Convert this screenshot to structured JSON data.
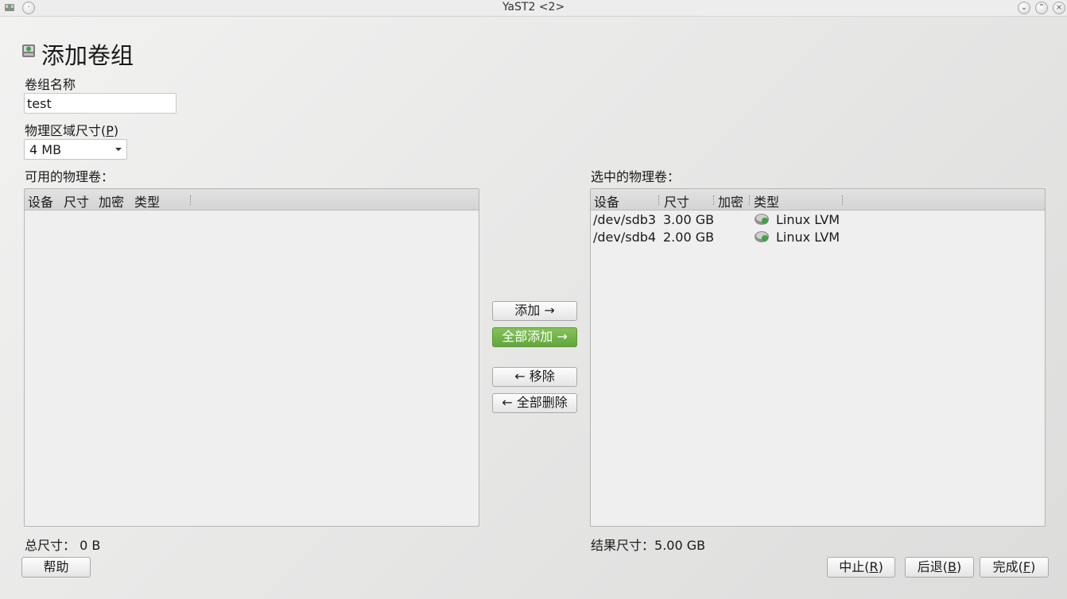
{
  "window": {
    "title": "YaST2 <2>",
    "icon": "drive-icon"
  },
  "page": {
    "heading": "添加卷组",
    "heading_icon": "drive-icon"
  },
  "vg_name": {
    "label": "卷组名称",
    "value": "test"
  },
  "pe_size": {
    "label_text": "物理区域尺寸(",
    "label_accel": "P",
    "label_end": ")",
    "selected": "4 MB"
  },
  "available": {
    "label": "可用的物理卷：",
    "columns": [
      "设备",
      "尺寸",
      "加密",
      "类型"
    ],
    "rows": [],
    "total_label": "总尺寸：",
    "total_value": "0 B"
  },
  "selected": {
    "label": "选中的物理卷：",
    "columns": [
      "设备",
      "尺寸",
      "加密",
      "类型"
    ],
    "rows": [
      {
        "device": "/dev/sdb3",
        "size": "3.00 GB",
        "encrypted": "",
        "type": "Linux LVM",
        "icon": "lvm-disk-icon"
      },
      {
        "device": "/dev/sdb4",
        "size": "2.00 GB",
        "encrypted": "",
        "type": "Linux LVM",
        "icon": "lvm-disk-icon"
      }
    ],
    "result_label": "结果尺寸：",
    "result_value": "5.00 GB"
  },
  "actions": {
    "add": "添加 →",
    "add_all": "全部添加 →",
    "remove": "← 移除",
    "remove_all": "← 全部删除"
  },
  "footer": {
    "help": "帮助",
    "abort_text": "中止(",
    "abort_accel": "R",
    "abort_end": ")",
    "back_text": "后退(",
    "back_accel": "B",
    "back_end": ")",
    "finish_text": "完成(",
    "finish_accel": "F",
    "finish_end": ")"
  },
  "colors": {
    "accent_green": "#6cb043",
    "background": "#e8e8e7",
    "table_bg": "#efefef"
  }
}
